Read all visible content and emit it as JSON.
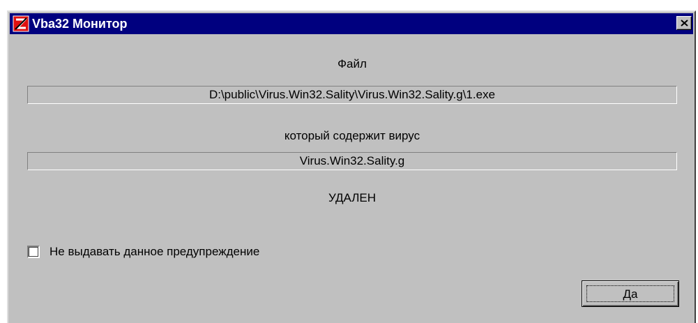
{
  "window": {
    "title": "Vba32 Монитор",
    "title_bar_color": "#00007f",
    "background_color": "#c0c0c0"
  },
  "icons": {
    "app": "vba32-app-icon",
    "close": "close-x-icon"
  },
  "body": {
    "file_label": "Файл",
    "file_path": "D:\\public\\Virus.Win32.Sality\\Virus.Win32.Sality.g\\1.exe",
    "virus_label": "который содержит вирус",
    "virus_name": "Virus.Win32.Sality.g",
    "status": "УДАЛЕН"
  },
  "checkbox": {
    "label": "Не выдавать данное предупреждение",
    "checked": false
  },
  "buttons": {
    "ok_label": "Да"
  }
}
